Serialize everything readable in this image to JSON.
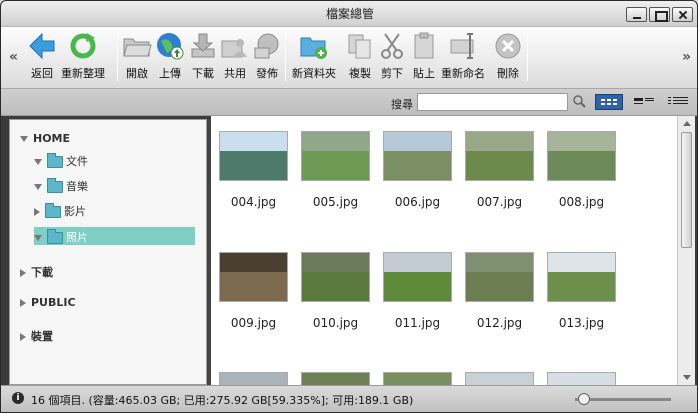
{
  "window": {
    "title": "檔案總管"
  },
  "toolbar": {
    "back": "返回",
    "refresh": "重新整理",
    "open": "開啟",
    "upload": "上傳",
    "download": "下載",
    "share": "共用",
    "publish": "發佈",
    "new_folder": "新資料夾",
    "copy": "複製",
    "cut": "剪下",
    "paste": "貼上",
    "rename": "重新命名",
    "delete": "刪除"
  },
  "search": {
    "label": "搜尋",
    "value": ""
  },
  "sidebar": {
    "home": "HOME",
    "documents": "文件",
    "music": "音樂",
    "videos": "影片",
    "photos": "照片",
    "downloads": "下載",
    "public": "PUBLIC",
    "devices": "裝置"
  },
  "files": [
    {
      "name": "004.jpg",
      "sky": "#c9dff0",
      "land": "#4d7a6a"
    },
    {
      "name": "005.jpg",
      "sky": "#8fa88a",
      "land": "#6f9a55"
    },
    {
      "name": "006.jpg",
      "sky": "#b6c9d9",
      "land": "#7a8f63"
    },
    {
      "name": "007.jpg",
      "sky": "#9aa88a",
      "land": "#6d8a4c"
    },
    {
      "name": "008.jpg",
      "sky": "#a6b59a",
      "land": "#6c8a5a"
    },
    {
      "name": "009.jpg",
      "sky": "#4a4032",
      "land": "#7c6a4e"
    },
    {
      "name": "010.jpg",
      "sky": "#6a7a5a",
      "land": "#5b7a3e"
    },
    {
      "name": "011.jpg",
      "sky": "#c4cbd2",
      "land": "#5e8a3a"
    },
    {
      "name": "012.jpg",
      "sky": "#7f8f72",
      "land": "#6d7f52"
    },
    {
      "name": "013.jpg",
      "sky": "#dfe4e8",
      "land": "#6d8f4c"
    },
    {
      "name": "",
      "sky": "#aab3b8",
      "land": "#5e6a5a"
    },
    {
      "name": "",
      "sky": "#6c7f55",
      "land": "#3f5a2c"
    },
    {
      "name": "",
      "sky": "#7a8f5f",
      "land": "#4e6a36"
    },
    {
      "name": "",
      "sky": "#c8d0d8",
      "land": "#9aa5ad"
    },
    {
      "name": "",
      "sky": "#d8dde3",
      "land": "#5678a0"
    }
  ],
  "status": {
    "text": "16 個項目. (容量:465.03 GB; 已用:275.92 GB[59.335%]; 可用:189.1 GB)"
  },
  "colors": {
    "selected": "#7fcfc4",
    "folder": "#5db6c9",
    "accent": "#2f62a8"
  }
}
